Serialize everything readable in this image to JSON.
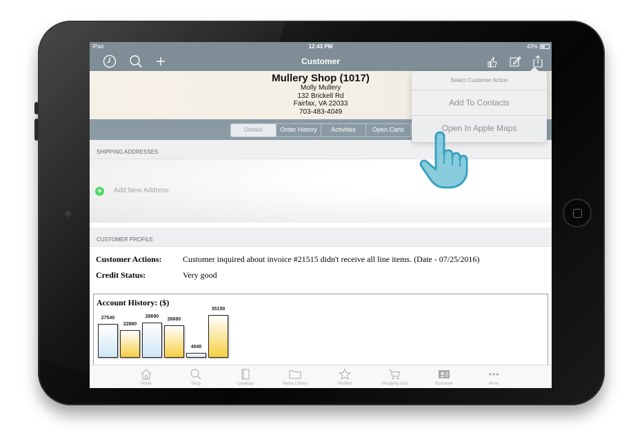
{
  "statusbar": {
    "carrier": "iPad",
    "time": "12:43 PM",
    "battery": "43%"
  },
  "navbar": {
    "title": "Customer"
  },
  "customer": {
    "shop": "Mullery Shop (1017)",
    "contact": "Molly Mullery",
    "street": "132 Brickell Rd",
    "city": "Fairfax, VA 22033",
    "phone": "703-483-4049"
  },
  "segments": [
    "Details",
    "Order History",
    "Activities",
    "Open Carts"
  ],
  "shipping": {
    "header": "SHIPPING ADDRESSES",
    "add_label": "Add New Address"
  },
  "profile": {
    "header": "CUSTOMER PROFILE",
    "actions_label": "Customer Actions:",
    "actions_value": "Customer inquired about invoice #21515 didn't receive all line items. (Date - 07/25/2016)",
    "credit_label": "Credit Status:",
    "credit_value": "Very good"
  },
  "chart_data": {
    "type": "bar",
    "title": "Account History: ($)",
    "values": [
      27540,
      22860,
      28690,
      26680,
      4040,
      35150
    ],
    "bar_colors": [
      "blue",
      "yellow",
      "blue",
      "yellow",
      "blue",
      "yellow"
    ],
    "ylim": [
      0,
      35150
    ]
  },
  "popover": {
    "title": "Select Customer Action",
    "items": [
      "Add To Contacts",
      "Open In Apple Maps"
    ]
  },
  "tabbar": {
    "items": [
      {
        "label": "Home",
        "icon": "home-icon"
      },
      {
        "label": "Shop",
        "icon": "search-icon"
      },
      {
        "label": "Catalogs",
        "icon": "book-icon"
      },
      {
        "label": "Media Library",
        "icon": "folder-icon"
      },
      {
        "label": "Wishlist",
        "icon": "star-icon"
      },
      {
        "label": "Shopping Cart",
        "icon": "cart-icon"
      },
      {
        "label": "Customer",
        "icon": "contact-card-icon"
      },
      {
        "label": "More",
        "icon": "more-icon"
      }
    ]
  },
  "colors": {
    "navbar": "#7f8e96",
    "segment_bar": "#8a9ba3",
    "add_green": "#4cd964",
    "hand_fill": "#7cc6d9"
  }
}
